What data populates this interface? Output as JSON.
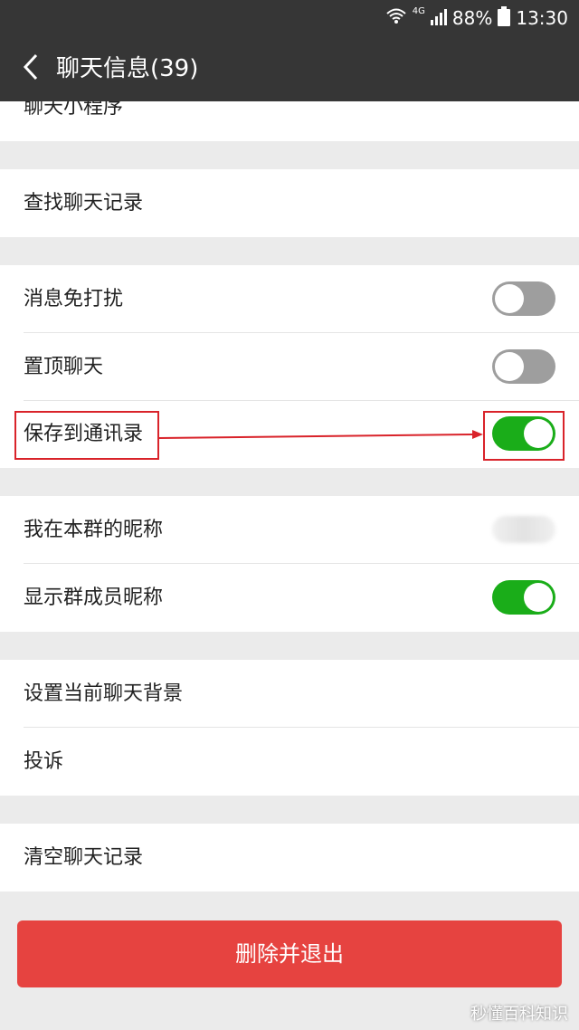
{
  "statusbar": {
    "network": "4G",
    "battery": "88%",
    "time": "13:30",
    "icons": [
      "wifi-icon",
      "signal-icon",
      "battery-icon"
    ]
  },
  "header": {
    "title": "聊天信息(39)",
    "back_icon": "back-chevron-icon"
  },
  "items": {
    "mini_program": "聊天小程序",
    "search_history": "查找聊天记录",
    "mute": {
      "label": "消息免打扰",
      "on": false
    },
    "sticky": {
      "label": "置顶聊天",
      "on": false
    },
    "save_contacts": {
      "label": "保存到通讯录",
      "on": true
    },
    "my_nickname": "我在本群的昵称",
    "show_nicknames": {
      "label": "显示群成员昵称",
      "on": true
    },
    "set_background": "设置当前聊天背景",
    "complain": "投诉",
    "clear_history": "清空聊天记录"
  },
  "delete_button": "删除并退出",
  "watermark": "秒懂百科知识",
  "colors": {
    "header_bg": "#363636",
    "toggle_on": "#1aad19",
    "toggle_off": "#9e9e9e",
    "danger": "#e64340",
    "highlight": "#d9232a"
  }
}
